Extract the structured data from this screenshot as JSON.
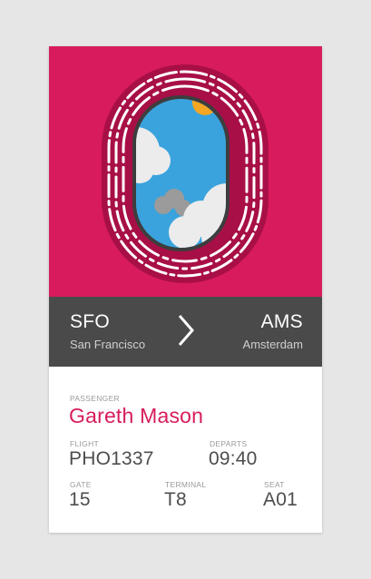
{
  "colors": {
    "accent": "#d81b5c",
    "window_frame": "#a80f47",
    "route_bg": "#4a4a4a",
    "sky": "#3aa3dd",
    "sun": "#f5a623",
    "page_bg": "#e6e6e6"
  },
  "route": {
    "from_code": "SFO",
    "from_city": "San Francisco",
    "to_code": "AMS",
    "to_city": "Amsterdam",
    "arrow_icon": "chevron-right-icon"
  },
  "passenger": {
    "label": "PASSENGER",
    "name": "Gareth Mason"
  },
  "flight": {
    "label": "FLIGHT",
    "value": "PHO1337"
  },
  "departs": {
    "label": "DEPARTS",
    "value": "09:40"
  },
  "gate": {
    "label": "GATE",
    "value": "15"
  },
  "terminal": {
    "label": "TERMINAL",
    "value": "T8"
  },
  "seat": {
    "label": "SEAT",
    "value": "A01"
  }
}
